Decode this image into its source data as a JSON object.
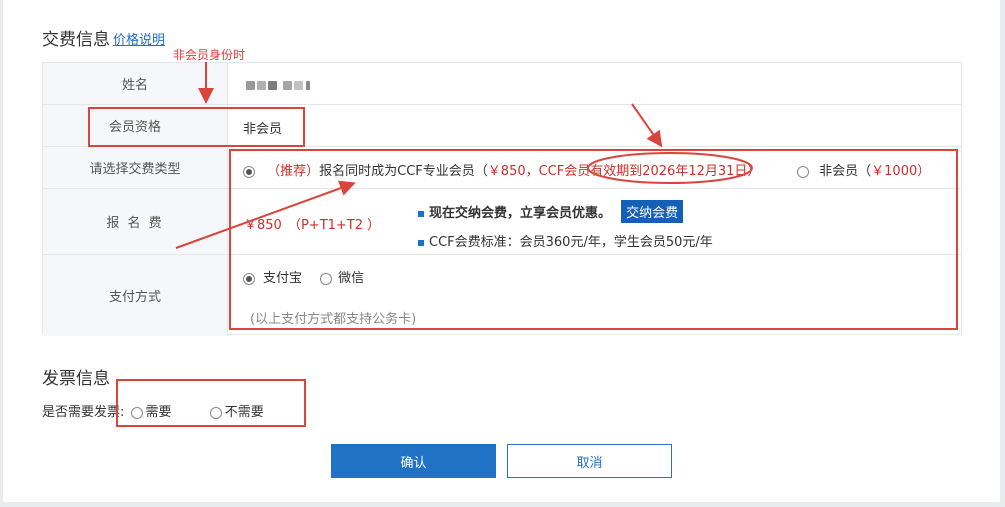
{
  "section_fee": {
    "title": "交费信息",
    "link": "价格说明",
    "note": "非会员身份时"
  },
  "form": {
    "name_label": "姓名",
    "member_label": "会员资格",
    "member_value": "非会员",
    "type_label": "请选择交费类型",
    "type_opt1_tag": "（推荐）",
    "type_opt1_text": "报名同时成为CCF专业会员（",
    "type_opt1_red": "￥850，CCF会员有效期到2026年12月31日）",
    "type_opt2_text": "非会员（",
    "type_opt2_red": "￥1000）",
    "fee_label": "报 名 费",
    "fee_value": "￥850",
    "fee_formula": "（P+T1+T2 ）",
    "promo_text": "现在交纳会费，立享会员优惠。",
    "promo_button": "交纳会费",
    "standard_text": "CCF会费标准：会员360元/年，学生会员50元/年",
    "pay_label": "支付方式",
    "pay_opt1": "支付宝",
    "pay_opt2": "微信",
    "pay_note": "(以上支付方式都支持公务卡)"
  },
  "section_invoice": {
    "title": "发票信息",
    "question": "是否需要发票:",
    "opt1": "需要",
    "opt2": "不需要"
  },
  "buttons": {
    "confirm": "确认",
    "cancel": "取消"
  },
  "colors": {
    "annotation": "#d9453d",
    "primary": "#1f72c6",
    "highlight": "#c9302c"
  }
}
